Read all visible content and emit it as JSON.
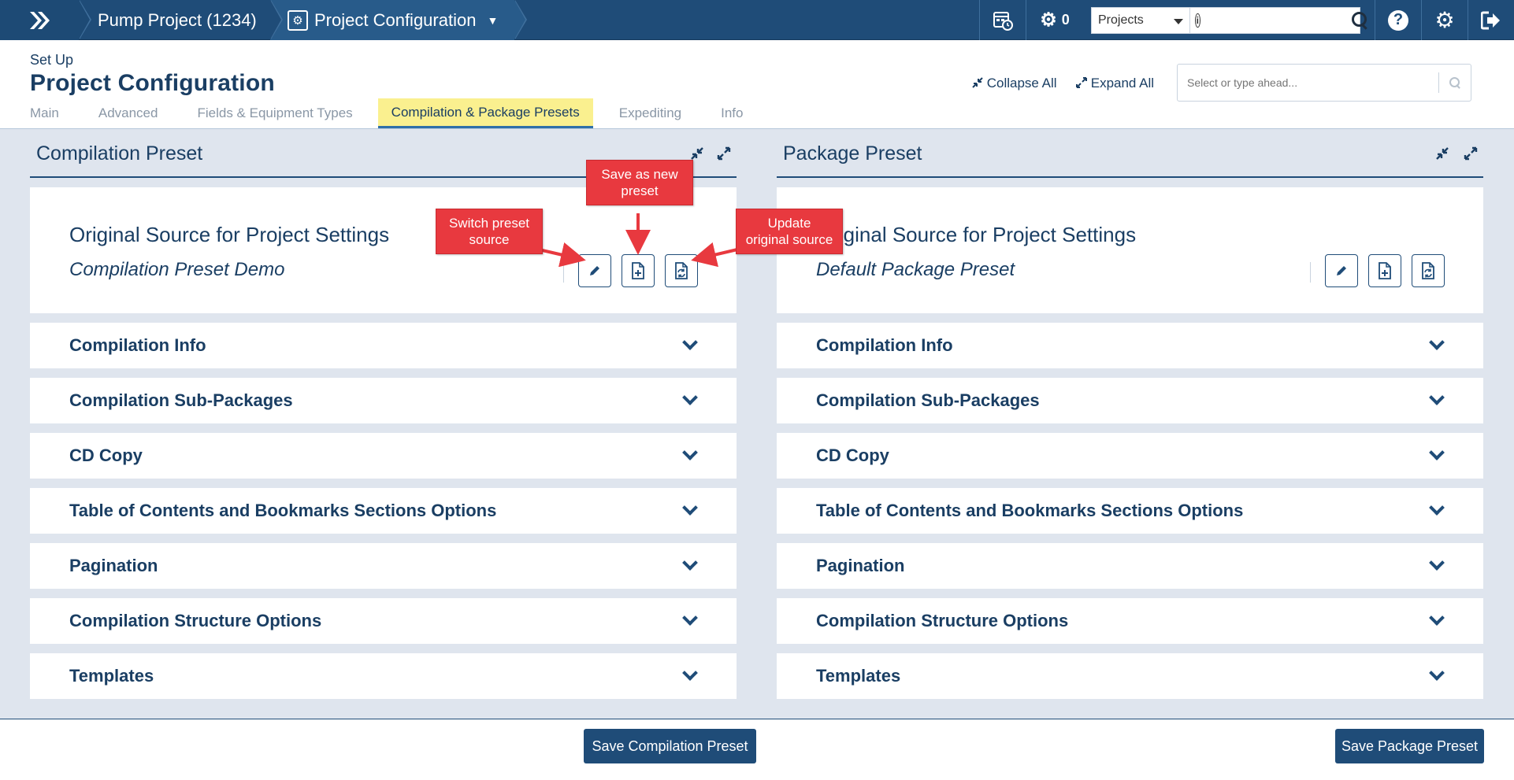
{
  "topbar": {
    "breadcrumb": [
      {
        "label": "Pump Project (1234)"
      },
      {
        "label": "Project Configuration"
      }
    ],
    "jobs_count": "0",
    "scope_select": "Projects",
    "search_placeholder": ""
  },
  "header": {
    "section": "Set Up",
    "title": "Project Configuration",
    "collapse_all": "Collapse All",
    "expand_all": "Expand All",
    "search_placeholder": "Select or type ahead...",
    "tabs": [
      {
        "label": "Main"
      },
      {
        "label": "Advanced"
      },
      {
        "label": "Fields & Equipment Types"
      },
      {
        "label": "Compilation & Package Presets",
        "active": true
      },
      {
        "label": "Expediting"
      },
      {
        "label": "Info"
      }
    ]
  },
  "compilation_preset": {
    "title": "Compilation Preset",
    "source_heading": "Original Source for Project Settings",
    "source_name": "Compilation Preset Demo",
    "sections": [
      "Compilation Info",
      "Compilation Sub-Packages",
      "CD Copy",
      "Table of Contents and Bookmarks Sections Options",
      "Pagination",
      "Compilation Structure Options",
      "Templates"
    ]
  },
  "package_preset": {
    "title": "Package Preset",
    "source_heading": "Original Source for Project Settings",
    "source_name": "Default Package Preset",
    "sections": [
      "Compilation Info",
      "Compilation Sub-Packages",
      "CD Copy",
      "Table of Contents and Bookmarks Sections Options",
      "Pagination",
      "Compilation Structure Options",
      "Templates"
    ]
  },
  "callouts": {
    "switch": "Switch preset source",
    "save_new": "Save as new preset",
    "update": "Update original source"
  },
  "footer": {
    "save_compilation": "Save Compilation Preset",
    "save_package": "Save Package Preset"
  },
  "colors": {
    "nav": "#1f4c78",
    "active_tab": "#faf08f",
    "callout": "#e8393f",
    "panel_bg": "#dfe5ee"
  }
}
